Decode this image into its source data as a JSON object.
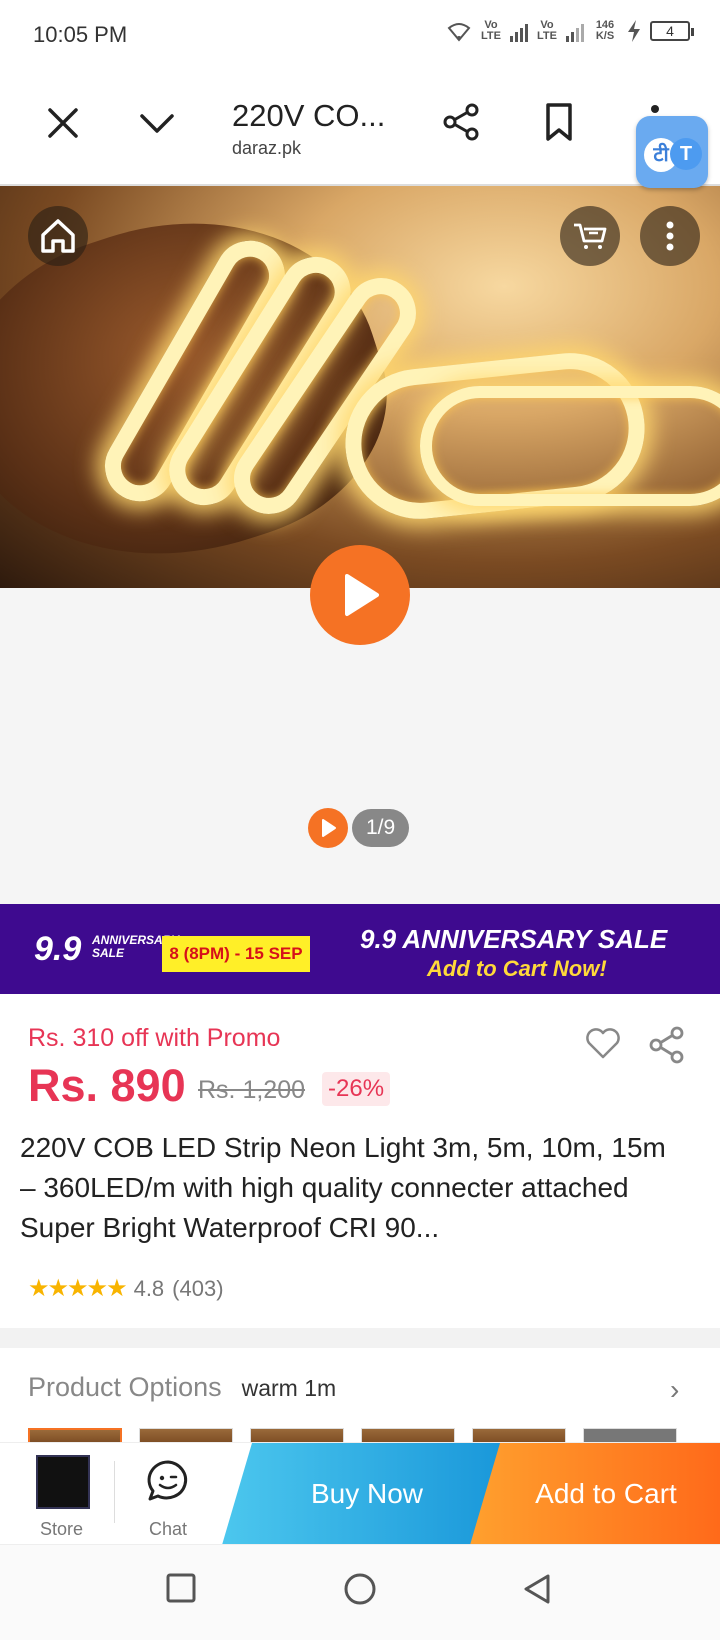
{
  "status_bar": {
    "time": "10:05 PM",
    "lte1": "Vo LTE",
    "lte2": "Vo LTE",
    "speed": "146 K/S",
    "battery": "4"
  },
  "browser": {
    "title": "220V CO...",
    "domain": "daraz.pk",
    "translate_badge_a": "टी",
    "translate_badge_b": "T",
    "icons": [
      "close-icon",
      "chevron-down-icon",
      "share-icon",
      "bookmark-icon",
      "more-vert-icon"
    ]
  },
  "gallery": {
    "page_counter": "1/9",
    "icons": [
      "home-icon",
      "cart-icon",
      "more-vert-icon",
      "play-icon"
    ]
  },
  "banner": {
    "logo_number": "9.9",
    "logo_text": "ANNIVERSARY SALE",
    "date_range": "8 (8PM) - 15 SEP",
    "headline": "9.9 ANNIVERSARY SALE",
    "cta": "Add to Cart Now!"
  },
  "product": {
    "promo": "Rs. 310 off with Promo",
    "price": "Rs. 890",
    "original_price": "Rs. 1,200",
    "discount": "-26%",
    "title": "220V COB LED Strip Neon Light 3m, 5m, 10m, 15m – 360LED/m with high quality connecter attached Super Bright Waterproof CRI 90...",
    "stars": "★★★★★",
    "rating": "4.8",
    "reviews": "(403)"
  },
  "options": {
    "label": "Product Options",
    "value": "warm 1m",
    "chevron": "›"
  },
  "action_bar": {
    "store_label": "Store",
    "chat_label": "Chat",
    "buy_now": "Buy Now",
    "add_to_cart": "Add to Cart"
  },
  "colors": {
    "accent_orange": "#f57224",
    "price_red": "#e73555",
    "banner_purple": "#3e0a8f",
    "buy_blue": "#1896d9"
  }
}
